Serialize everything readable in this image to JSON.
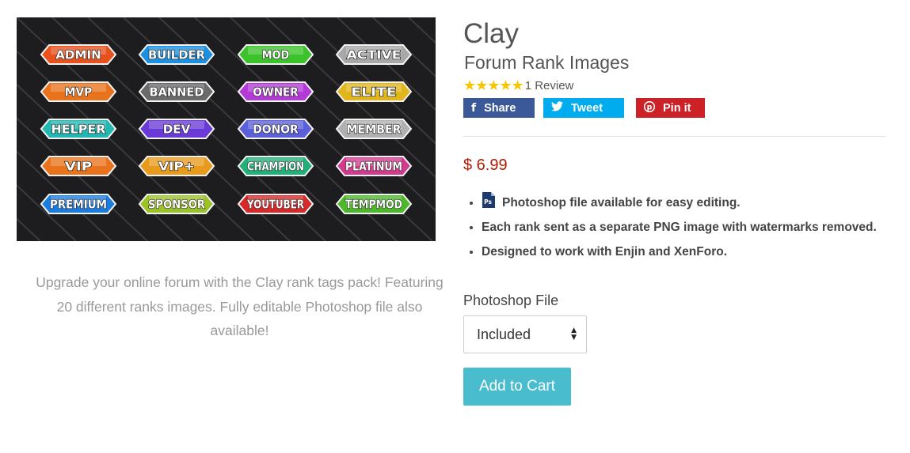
{
  "product": {
    "title": "Clay",
    "subtitle": "Forum Rank Images",
    "rating_stars": "★★★★★",
    "review_count": "1 Review",
    "price": "$ 6.99",
    "description": "Upgrade your online forum with the Clay rank tags pack! Featuring 20 different ranks images. Fully editable Photoshop file also available!"
  },
  "share": {
    "facebook_icon": "f",
    "facebook": "Share",
    "twitter_icon": "🐦",
    "twitter": "Tweet",
    "pinterest_icon": "p",
    "pinterest": "Pin it"
  },
  "features": [
    "Photoshop file available for easy editing.",
    "Each rank sent as a separate PNG image with watermarks removed.",
    "Designed to work with Enjin and XenForo."
  ],
  "option": {
    "label": "Photoshop File",
    "selected": "Included"
  },
  "cart": {
    "label": "Add to Cart"
  },
  "ranks": [
    {
      "label": "ADMIN",
      "color": "#e8501c"
    },
    {
      "label": "BUILDER",
      "color": "#1b8fe0"
    },
    {
      "label": "MOD",
      "color": "#3cc22a"
    },
    {
      "label": "ACTIVE",
      "color": "#a8a8a8"
    },
    {
      "label": "MVP",
      "color": "#e8731c"
    },
    {
      "label": "BANNED",
      "color": "#6a6a6a"
    },
    {
      "label": "OWNER",
      "color": "#b33ad6"
    },
    {
      "label": "ELITE",
      "color": "#e0b61b"
    },
    {
      "label": "HELPER",
      "color": "#22b7b0"
    },
    {
      "label": "DEV",
      "color": "#6a3ad6"
    },
    {
      "label": "DONOR",
      "color": "#5b5fd8"
    },
    {
      "label": "MEMBER",
      "color": "#b0b0b0"
    },
    {
      "label": "VIP",
      "color": "#e8731c"
    },
    {
      "label": "VIP+",
      "color": "#e89a1c"
    },
    {
      "label": "CHAMPION",
      "color": "#22b07a"
    },
    {
      "label": "PLATINUM",
      "color": "#d23a8e"
    },
    {
      "label": "PREMIUM",
      "color": "#1b7ce0"
    },
    {
      "label": "SPONSOR",
      "color": "#9cc22a"
    },
    {
      "label": "YOUTUBER",
      "color": "#d62a2a"
    },
    {
      "label": "TEMPMOD",
      "color": "#4cb82a"
    }
  ]
}
